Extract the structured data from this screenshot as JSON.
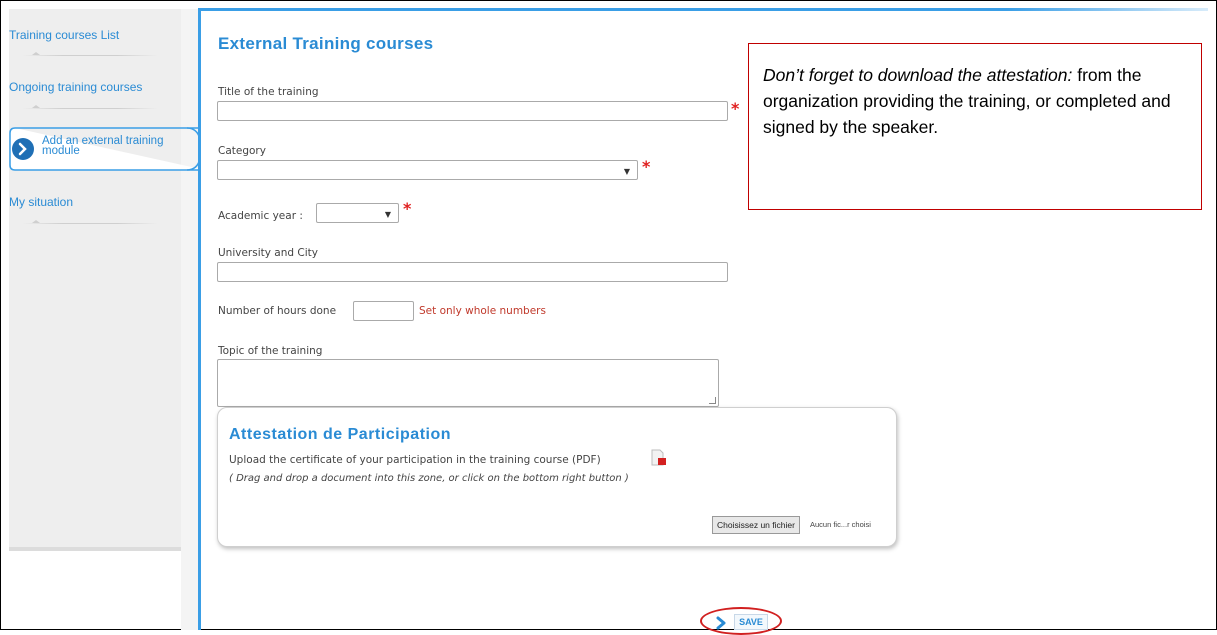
{
  "sidebar": {
    "items": [
      {
        "label": "Training courses List"
      },
      {
        "label": "Ongoing training courses"
      },
      {
        "label": "Add an external training module"
      },
      {
        "label": "My situation"
      }
    ]
  },
  "form": {
    "title": "External Training courses",
    "title_label": "Title of the training",
    "title_value": "",
    "category_label": "Category",
    "category_value": "",
    "academic_year_label": "Academic year :",
    "academic_year_value": "",
    "university_label": "University and City",
    "university_value": "",
    "hours_label": "Number of hours done",
    "hours_value": "",
    "hours_hint": "Set only whole numbers",
    "topic_label": "Topic of the training",
    "topic_value": "",
    "required_mark": "*"
  },
  "upload": {
    "title": "Attestation de Participation",
    "description": "Upload the certificate of your participation in the training course (PDF)",
    "hint": "( Drag and drop a document into this zone, or click on the bottom right button )",
    "file_button": "Choisissez un fichier",
    "file_status": "Aucun fic...r choisi"
  },
  "save": {
    "label": "SAVE"
  },
  "callout": {
    "italic": "Don’t forget to download the attestation:",
    "text": " from the organization providing the training, or completed and signed by the speaker."
  },
  "colors": {
    "accent": "#2a8bd4",
    "required": "#e02020",
    "highlight": "#d12020"
  },
  "icons": [
    "chevron-right-icon",
    "pdf-icon",
    "dropdown-arrow-icon"
  ]
}
